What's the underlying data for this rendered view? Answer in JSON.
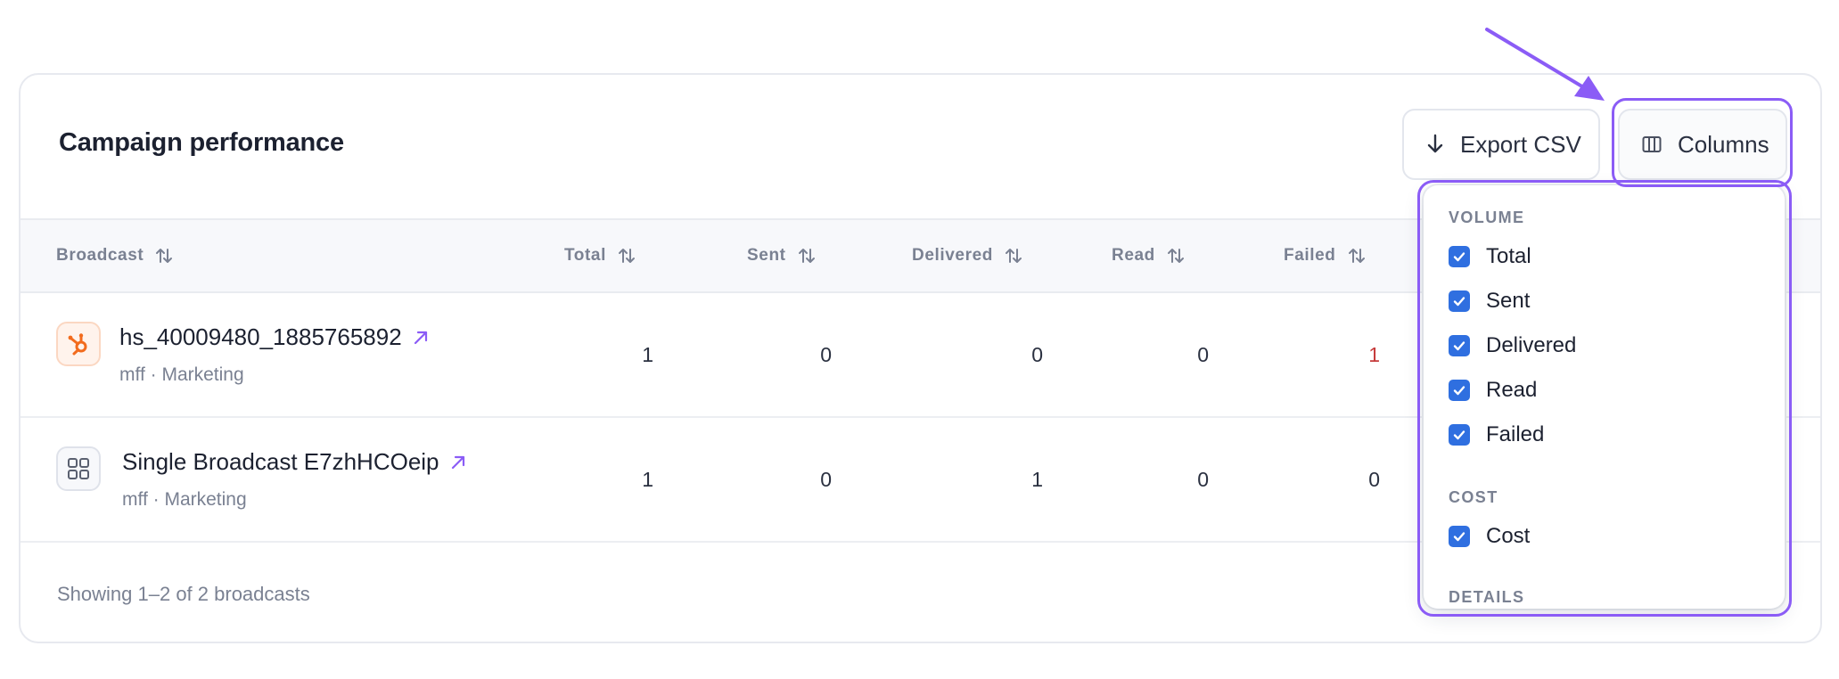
{
  "card": {
    "title": "Campaign performance",
    "export_label": "Export CSV",
    "columns_label": "Columns"
  },
  "table": {
    "headers": [
      "Broadcast",
      "Total",
      "Sent",
      "Delivered",
      "Read",
      "Failed"
    ],
    "rows": [
      {
        "name": "hs_40009480_1885765892",
        "subtitle": "mff · Marketing",
        "icon": "hubspot-icon",
        "total": "1",
        "sent": "0",
        "delivered": "0",
        "read": "0",
        "failed": "1"
      },
      {
        "name": "Single Broadcast E7zhHCOeip",
        "subtitle": "mff · Marketing",
        "icon": "grid-icon",
        "total": "1",
        "sent": "0",
        "delivered": "1",
        "read": "0",
        "failed": "0"
      }
    ]
  },
  "footer": {
    "summary": "Showing 1–2 of 2 broadcasts"
  },
  "columns_menu": {
    "volume_heading": "VOLUME",
    "volume_items": [
      {
        "label": "Total",
        "checked": true
      },
      {
        "label": "Sent",
        "checked": true
      },
      {
        "label": "Delivered",
        "checked": true
      },
      {
        "label": "Read",
        "checked": true
      },
      {
        "label": "Failed",
        "checked": true
      }
    ],
    "cost_heading": "COST",
    "cost_items": [
      {
        "label": "Cost",
        "checked": true
      }
    ],
    "details_heading": "DETAILS"
  },
  "colors": {
    "accent": "#8b5cf6",
    "checkbox": "#2f6fe0",
    "failed": "#c53a3a",
    "hubspot": "#f26b1d"
  }
}
